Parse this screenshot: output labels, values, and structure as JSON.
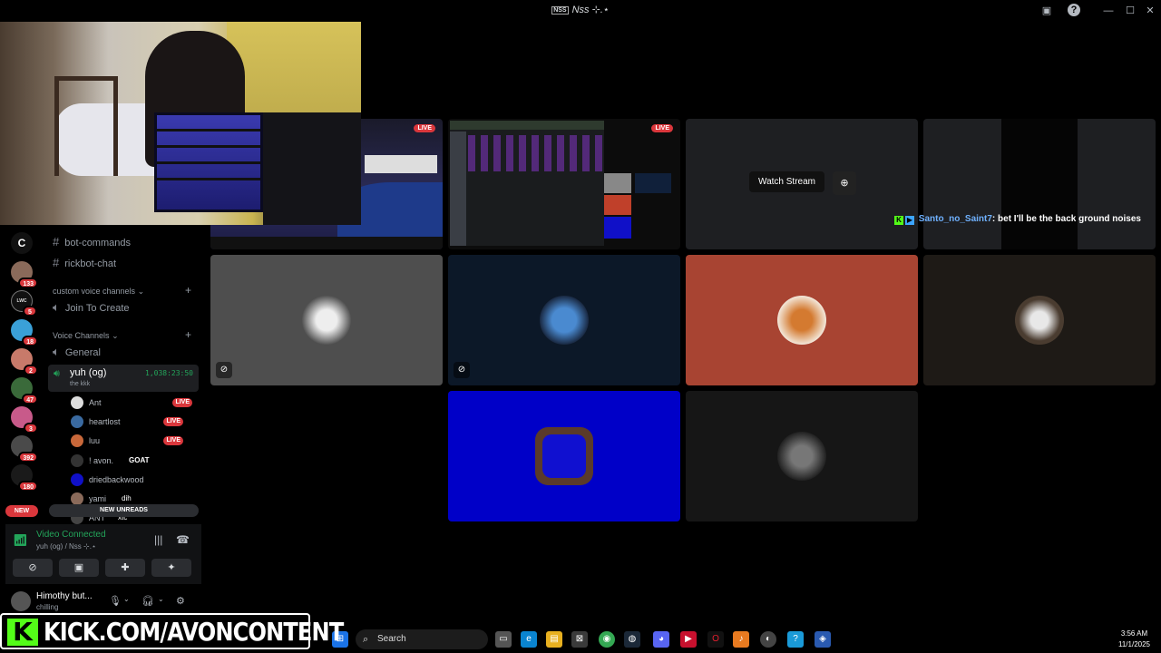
{
  "window": {
    "title": "Nss ⊹.⋆",
    "logo_text": "NSS"
  },
  "kick_overlay": {
    "logo": "K",
    "text": "KICK.COM/AVONCONTENT"
  },
  "servers": [
    {
      "label": "C"
    },
    {
      "badge": "133"
    },
    {
      "label": "LWC",
      "badge": "5"
    },
    {
      "badge": "18"
    },
    {
      "badge": "2"
    },
    {
      "badge": "47"
    },
    {
      "badge": "3"
    },
    {
      "badge": "392"
    },
    {
      "badge": "180"
    }
  ],
  "servers_new": "NEW",
  "channels": [
    {
      "name": "bot-commands"
    },
    {
      "name": "rickbot-chat"
    }
  ],
  "categories": {
    "custom": "custom voice channels",
    "voice": "Voice Channels"
  },
  "voice_channels": {
    "join_to_create": "Join To Create",
    "general": "General",
    "active": {
      "name": "yuh (og)",
      "subtitle": "the kkk",
      "timer": "1,038:23:50"
    }
  },
  "members": [
    {
      "name": "Ant",
      "live": "LIVE"
    },
    {
      "name": "heartlost",
      "live": "LIVE"
    },
    {
      "name": "luu",
      "live": "LIVE"
    },
    {
      "name": "! avon.",
      "tag": "GOAT"
    },
    {
      "name": "driedbackwood"
    },
    {
      "name": "yami",
      "tag": "dih"
    },
    {
      "name": "ANT",
      "tag": "xtc"
    }
  ],
  "new_unreads": "NEW UNREADS",
  "voice_panel": {
    "status": "Video Connected",
    "location": "yuh (og) / Nss ⊹.⋆"
  },
  "user_panel": {
    "name": "Himothy but...",
    "status": "chilling"
  },
  "grid": {
    "live_label": "LIVE",
    "watch_stream": "Watch Stream",
    "chat": {
      "user": "Santo_no_Saint7",
      "message": ": bet I'll be the back ground noises"
    }
  },
  "taskbar": {
    "search_placeholder": "Search",
    "time": "3:56 AM",
    "date": "11/1/2025"
  },
  "colors": {
    "live": "#da373c",
    "connected": "#23a55a",
    "kick_green": "#53fc18",
    "tile_red": "#a84432",
    "tile_blue": "#0000c8"
  }
}
